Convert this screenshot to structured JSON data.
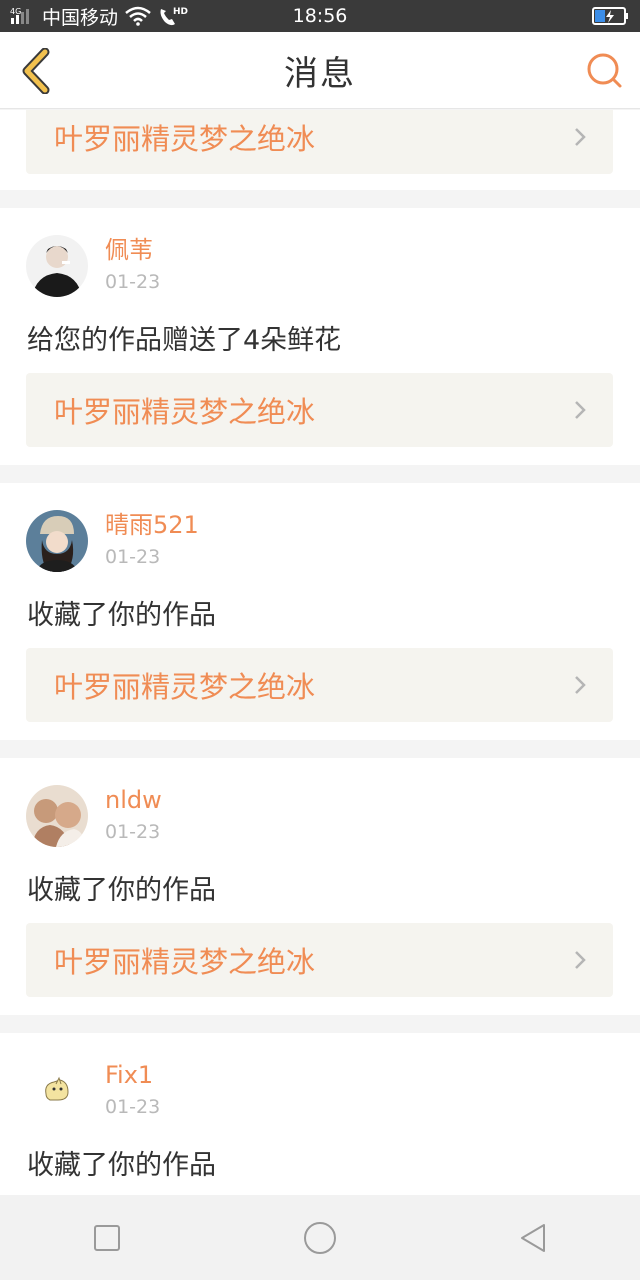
{
  "status_bar": {
    "carrier": "中国移动",
    "network": "4G",
    "hd": "HD",
    "time": "18:56"
  },
  "header": {
    "title": "消息"
  },
  "work_title": "叶罗丽精灵梦之绝冰",
  "messages": [
    {
      "name": "佩苇",
      "date": "01-23",
      "action": "给您的作品赠送了4朵鲜花",
      "work": "叶罗丽精灵梦之绝冰"
    },
    {
      "name": "晴雨521",
      "date": "01-23",
      "action": "收藏了你的作品",
      "work": "叶罗丽精灵梦之绝冰"
    },
    {
      "name": "nldw",
      "date": "01-23",
      "action": "收藏了你的作品",
      "work": "叶罗丽精灵梦之绝冰"
    },
    {
      "name": "Fix1",
      "date": "01-23",
      "action": "收藏了你的作品"
    }
  ],
  "colors": {
    "accent": "#f08c54",
    "back_arrow": "#f2c14e",
    "link_bg": "#f5f4ef"
  }
}
